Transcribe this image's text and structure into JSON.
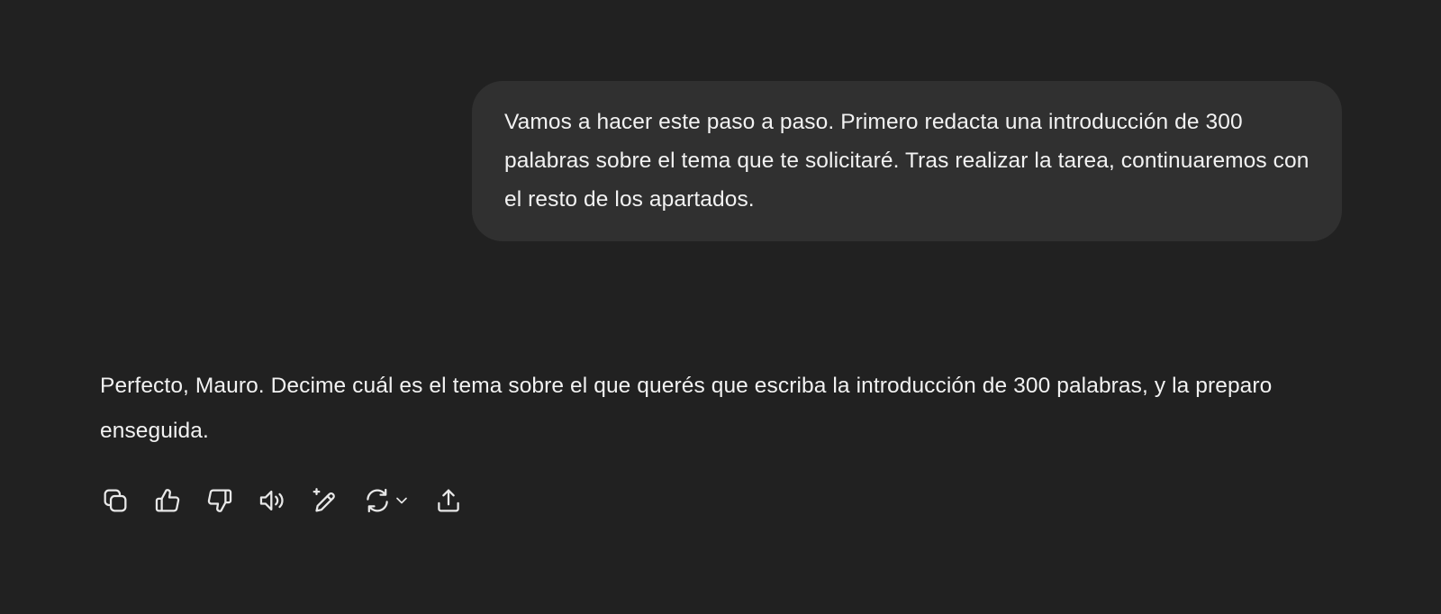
{
  "conversation": {
    "user_message": "Vamos a hacer este paso a paso. Primero redacta una introducción de 300 palabras sobre el tema que te solicitaré. Tras realizar la tarea, continuaremos con el resto de los apartados.",
    "assistant_message": "Perfecto, Mauro. Decime cuál es el tema sobre el que querés que escriba la introducción de 300 palabras, y la preparo enseguida."
  },
  "actions": [
    {
      "icon": "copy-icon"
    },
    {
      "icon": "thumbs-up-icon"
    },
    {
      "icon": "thumbs-down-icon"
    },
    {
      "icon": "read-aloud-icon"
    },
    {
      "icon": "edit-sparkle-icon"
    },
    {
      "icon": "regenerate-icon"
    },
    {
      "icon": "share-icon"
    }
  ],
  "colors": {
    "background": "#212121",
    "user_bubble": "#303030",
    "text": "#f2f2f2"
  }
}
